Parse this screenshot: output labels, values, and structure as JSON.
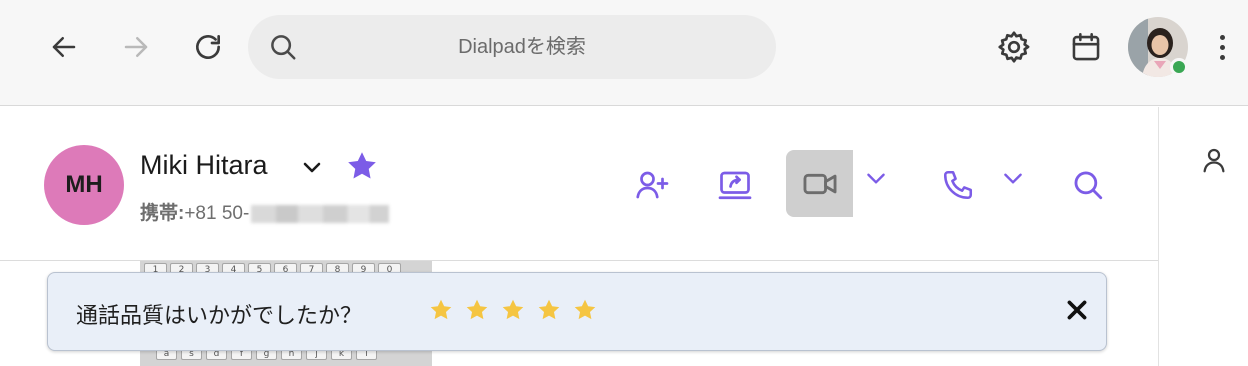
{
  "browser": {
    "search_placeholder": "Dialpadを検索",
    "back_icon": "arrow-left-icon",
    "forward_icon": "arrow-right-icon",
    "reload_icon": "reload-icon",
    "settings_icon": "gear-icon",
    "calendar_icon": "calendar-icon",
    "presence_status": "online"
  },
  "contact": {
    "initials": "MH",
    "name": "Miki Hitara",
    "phone_label": "携帯:",
    "phone_visible": "+81 50-",
    "favorite": true,
    "avatar_color": "#dd7ab9",
    "actions": [
      "add-person-icon",
      "screen-share-icon",
      "video-camera-icon",
      "phone-icon",
      "search-icon"
    ]
  },
  "accent_color": "#7c5ce7",
  "keyboard": {
    "top_row": [
      "1",
      "2",
      "3",
      "4",
      "5",
      "6",
      "7",
      "8",
      "9",
      "0"
    ],
    "bottom_row": [
      "a",
      "s",
      "d",
      "f",
      "g",
      "h",
      "j",
      "k",
      "l"
    ]
  },
  "rating_banner": {
    "question": "通話品質はいかがでしたか？",
    "star_count": 5,
    "star_color": "#f5c542",
    "close_icon": "close-icon"
  }
}
